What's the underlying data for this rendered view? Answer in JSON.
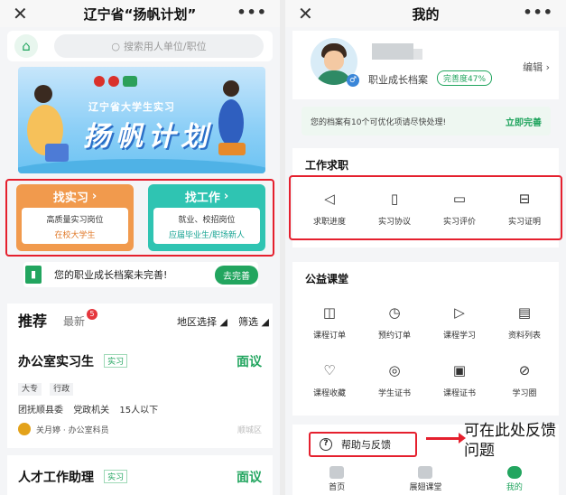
{
  "left": {
    "top_bar": {
      "close": "✕",
      "title": "辽宁省“扬帆计划”",
      "more": "•••"
    },
    "search": {
      "placeholder": "搜索用人单位/职位"
    },
    "banner": {
      "subtitle": "辽宁省大学生实习",
      "title": "扬帆计划"
    },
    "cards": [
      {
        "title": "找实习",
        "line1": "高质量实习岗位",
        "line2": "在校大学生",
        "color": "#f19a4d"
      },
      {
        "title": "找工作",
        "line1": "就业、校招岗位",
        "line2": "应届毕业生/职场新人",
        "color": "#2fc4b2"
      }
    ],
    "profile_banner": {
      "text": "您的职业成长档案未完善!",
      "button": "去完善"
    },
    "feed": {
      "tab_recommend": "推荐",
      "tab_latest": "最新",
      "latest_badge": "5",
      "filter_region": "地区选择",
      "filter_filter": "筛选",
      "jobs": [
        {
          "name": "办公室实习生",
          "tag": "实习",
          "pay": "面议",
          "chips": [
            "大专",
            "行政"
          ],
          "org": [
            "团抚顺县委",
            "党政机关",
            "15人以下"
          ],
          "contact": "关月婷 · 办公室科员",
          "district": "顺城区"
        },
        {
          "name": "人才工作助理",
          "tag": "实习",
          "pay": "面议"
        }
      ]
    }
  },
  "right": {
    "top_bar": {
      "close": "✕",
      "title": "我的",
      "more": "•••"
    },
    "profile": {
      "archive_label": "职业成长档案",
      "completion": "完善度47%",
      "edit": "编辑"
    },
    "notice": {
      "text": "您的档案有10个可优化项请尽快处理!",
      "action": "立即完善"
    },
    "job_section": {
      "title": "工作求职",
      "items": [
        {
          "label": "求职进度",
          "icon": "paper-plane-icon"
        },
        {
          "label": "实习协议",
          "icon": "document-icon"
        },
        {
          "label": "实习评价",
          "icon": "chat-icon"
        },
        {
          "label": "实习证明",
          "icon": "certificate-icon"
        }
      ]
    },
    "course_section": {
      "title": "公益课堂",
      "items": [
        {
          "label": "课程订单",
          "icon": "book-icon"
        },
        {
          "label": "预约订单",
          "icon": "alarm-clock-icon"
        },
        {
          "label": "课程学习",
          "icon": "tv-icon"
        },
        {
          "label": "资料列表",
          "icon": "folder-icon"
        },
        {
          "label": "课程收藏",
          "icon": "heart-icon"
        },
        {
          "label": "学生证书",
          "icon": "medal-icon"
        },
        {
          "label": "课程证书",
          "icon": "certificate-doc-icon"
        },
        {
          "label": "学习圈",
          "icon": "circle-icon"
        }
      ]
    },
    "help": {
      "label": "帮助与反馈",
      "annotation": "可在此处反馈问题"
    },
    "nav": [
      {
        "label": "首页",
        "active": false
      },
      {
        "label": "展翅课堂",
        "active": false
      },
      {
        "label": "我的",
        "active": true
      }
    ],
    "accent": "#22a55f",
    "highlight": "#e5202e"
  }
}
